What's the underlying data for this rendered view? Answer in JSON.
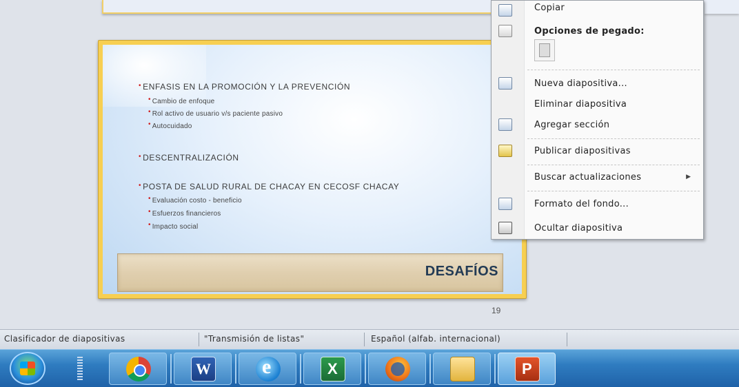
{
  "slide": {
    "bullets": [
      {
        "text": "ENFASIS EN LA PROMOCIÓN Y LA PREVENCIÓN",
        "subs": [
          "Cambio de enfoque",
          "Rol activo de usuario v/s paciente pasivo",
          "Autocuidado"
        ]
      },
      {
        "text": "DESCENTRALIZACIÓN",
        "subs": []
      },
      {
        "text": "POSTA DE SALUD RURAL DE CHACAY EN CECOSF CHACAY",
        "subs": [
          "Evaluación costo - beneficio",
          "Esfuerzos financieros",
          "Impacto social"
        ]
      }
    ],
    "footer_title": "DESAFÍOS",
    "number": "19"
  },
  "context_menu": {
    "items": [
      {
        "label": "Copiar",
        "icon": "copy-icon"
      },
      {
        "label": "Opciones de pegado:",
        "icon": "paste-options-icon"
      },
      {
        "label": "Nueva diapositiva...",
        "icon": "new-slide-icon"
      },
      {
        "label": "Eliminar diapositiva",
        "icon": ""
      },
      {
        "label": "Agregar sección",
        "icon": "add-section-icon"
      },
      {
        "label": "Publicar diapositivas",
        "icon": "publish-slides-icon"
      },
      {
        "label": "Buscar actualizaciones",
        "icon": "",
        "submenu": "▶"
      },
      {
        "label": "Formato del fondo...",
        "icon": "format-background-icon"
      },
      {
        "label": "Ocultar diapositiva",
        "icon": "hide-slide-icon"
      }
    ]
  },
  "statusbar": {
    "view": "Clasificador de diapositivas",
    "theme": "\"Transmisión de listas\"",
    "language": "Español (alfab. internacional)"
  },
  "taskbar": {
    "apps": [
      "start-orb-icon",
      "chrome-icon",
      "word-icon",
      "internet-explorer-icon",
      "excel-icon",
      "firefox-icon",
      "file-explorer-icon",
      "powerpoint-icon"
    ]
  }
}
